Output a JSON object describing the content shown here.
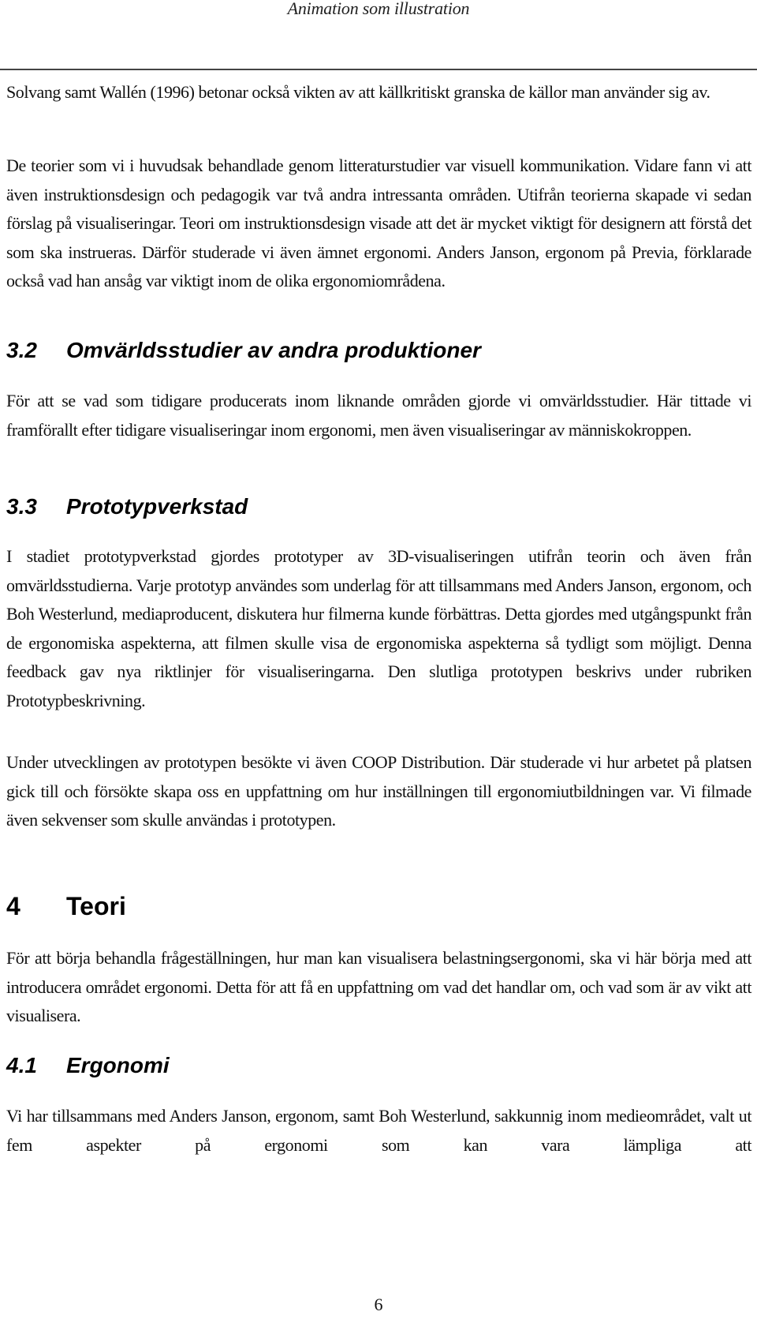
{
  "running_header": "Animation som illustration",
  "paragraphs": {
    "p1": "Solvang samt Wallén (1996) betonar också vikten av att källkritiskt granska de källor man använder sig av.",
    "p2": "De teorier som vi i huvudsak behandlade genom litteraturstudier var visuell kommunikation. Vidare fann vi att även instruktionsdesign och pedagogik var två andra intressanta områden. Utifrån teorierna skapade vi sedan förslag på visualiseringar. Teori om instruktionsdesign visade att det är mycket viktigt för designern att förstå det som ska instrueras. Därför studerade vi även ämnet ergonomi. Anders Janson, ergonom på Previa, förklarade också vad han ansåg var viktigt inom de olika ergonomiområdena.",
    "p3": "För att se vad som tidigare producerats inom liknande områden gjorde vi omvärldsstudier. Här tittade vi framförallt efter tidigare visualiseringar inom ergonomi, men även visualiseringar av människokroppen.",
    "p4": "I stadiet prototypverkstad gjordes prototyper av 3D-visualiseringen utifrån teorin och även från omvärldsstudierna. Varje prototyp användes som underlag för att tillsammans med Anders Janson, ergonom, och Boh Westerlund, mediaproducent, diskutera hur filmerna kunde förbättras. Detta gjordes med utgångspunkt från de ergonomiska aspekterna, att filmen skulle visa de ergonomiska aspekterna så tydligt som möjligt. Denna feedback gav nya riktlinjer för visualiseringarna. Den slutliga prototypen beskrivs under rubriken Prototypbeskrivning.",
    "p5": "Under utvecklingen av prototypen besökte vi även COOP Distribution. Där studerade vi hur arbetet på platsen gick till och försökte skapa oss en uppfattning om hur inställningen till ergonomiutbildningen var. Vi filmade även sekvenser som skulle användas i prototypen.",
    "p6": "För att börja behandla frågeställningen, hur man kan visualisera belastningsergonomi, ska vi här börja med att introducera området ergonomi. Detta för att få en uppfattning om vad det handlar om, och vad som är av vikt att visualisera.",
    "p7": "Vi har tillsammans med Anders Janson, ergonom, samt Boh Westerlund, sakkunnig inom medieområdet, valt ut fem aspekter på ergonomi som kan vara lämpliga att"
  },
  "headings": {
    "h32": {
      "number": "3.2",
      "title": "Omvärldsstudier av andra produktioner"
    },
    "h33": {
      "number": "3.3",
      "title": "Prototypverkstad"
    },
    "h4": {
      "number": "4",
      "title": "Teori"
    },
    "h41": {
      "number": "4.1",
      "title": "Ergonomi"
    }
  },
  "page_number": "6"
}
